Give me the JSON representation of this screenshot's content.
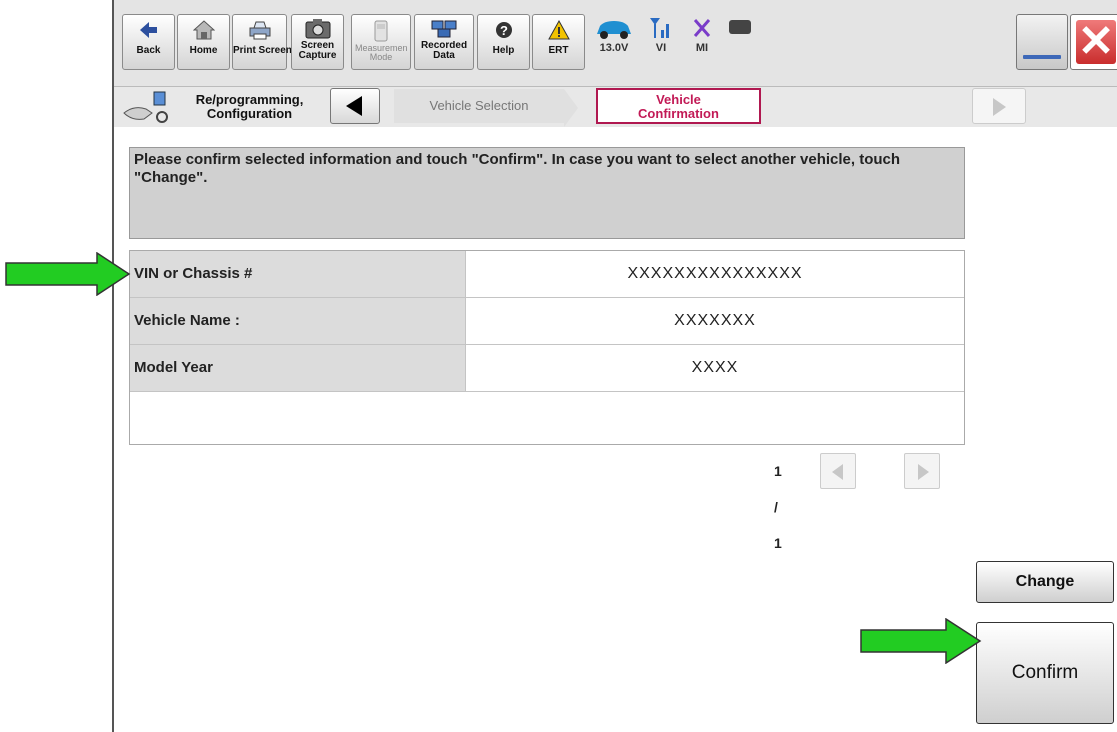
{
  "toolbar": {
    "buttons": [
      {
        "label": "Back",
        "icon": "back-arrow-icon",
        "enabled": true
      },
      {
        "label": "Home",
        "icon": "home-icon",
        "enabled": true
      },
      {
        "label": "Print Screen",
        "icon": "printer-icon",
        "enabled": true
      },
      {
        "label": "Screen Capture",
        "icon": "camera-icon",
        "enabled": true
      },
      {
        "label": "Measurement Mode",
        "icon": "meter-icon",
        "enabled": false
      },
      {
        "label": "Recorded Data",
        "icon": "recorded-data-icon",
        "enabled": true
      },
      {
        "label": "Help",
        "icon": "help-icon",
        "enabled": true
      },
      {
        "label": "ERT",
        "icon": "warning-icon",
        "enabled": true
      }
    ],
    "status": {
      "voltage": "13.0V",
      "vi": "VI",
      "mi": "MI"
    }
  },
  "breadcrumb": {
    "tool_label": "Re/programming, Configuration",
    "steps": [
      "Vehicle Selection",
      "Vehicle Confirmation"
    ],
    "active_step": "Vehicle Confirmation"
  },
  "message": "Please confirm selected information and touch \"Confirm\". In case you want to select another vehicle, touch \"Change\".",
  "vehicle_info": {
    "rows": [
      {
        "label": "VIN or Chassis #",
        "value": "XXXXXXXXXXXXXXX"
      },
      {
        "label": "Vehicle Name :",
        "value": "XXXXXXX"
      },
      {
        "label": "Model Year",
        "value": "XXXX"
      }
    ]
  },
  "pager": {
    "text": "1 / 1"
  },
  "actions": {
    "change_label": "Change",
    "confirm_label": "Confirm"
  },
  "colors": {
    "arrow": "#22cc22",
    "active_step": "#c21a56",
    "close": "#d33333"
  }
}
